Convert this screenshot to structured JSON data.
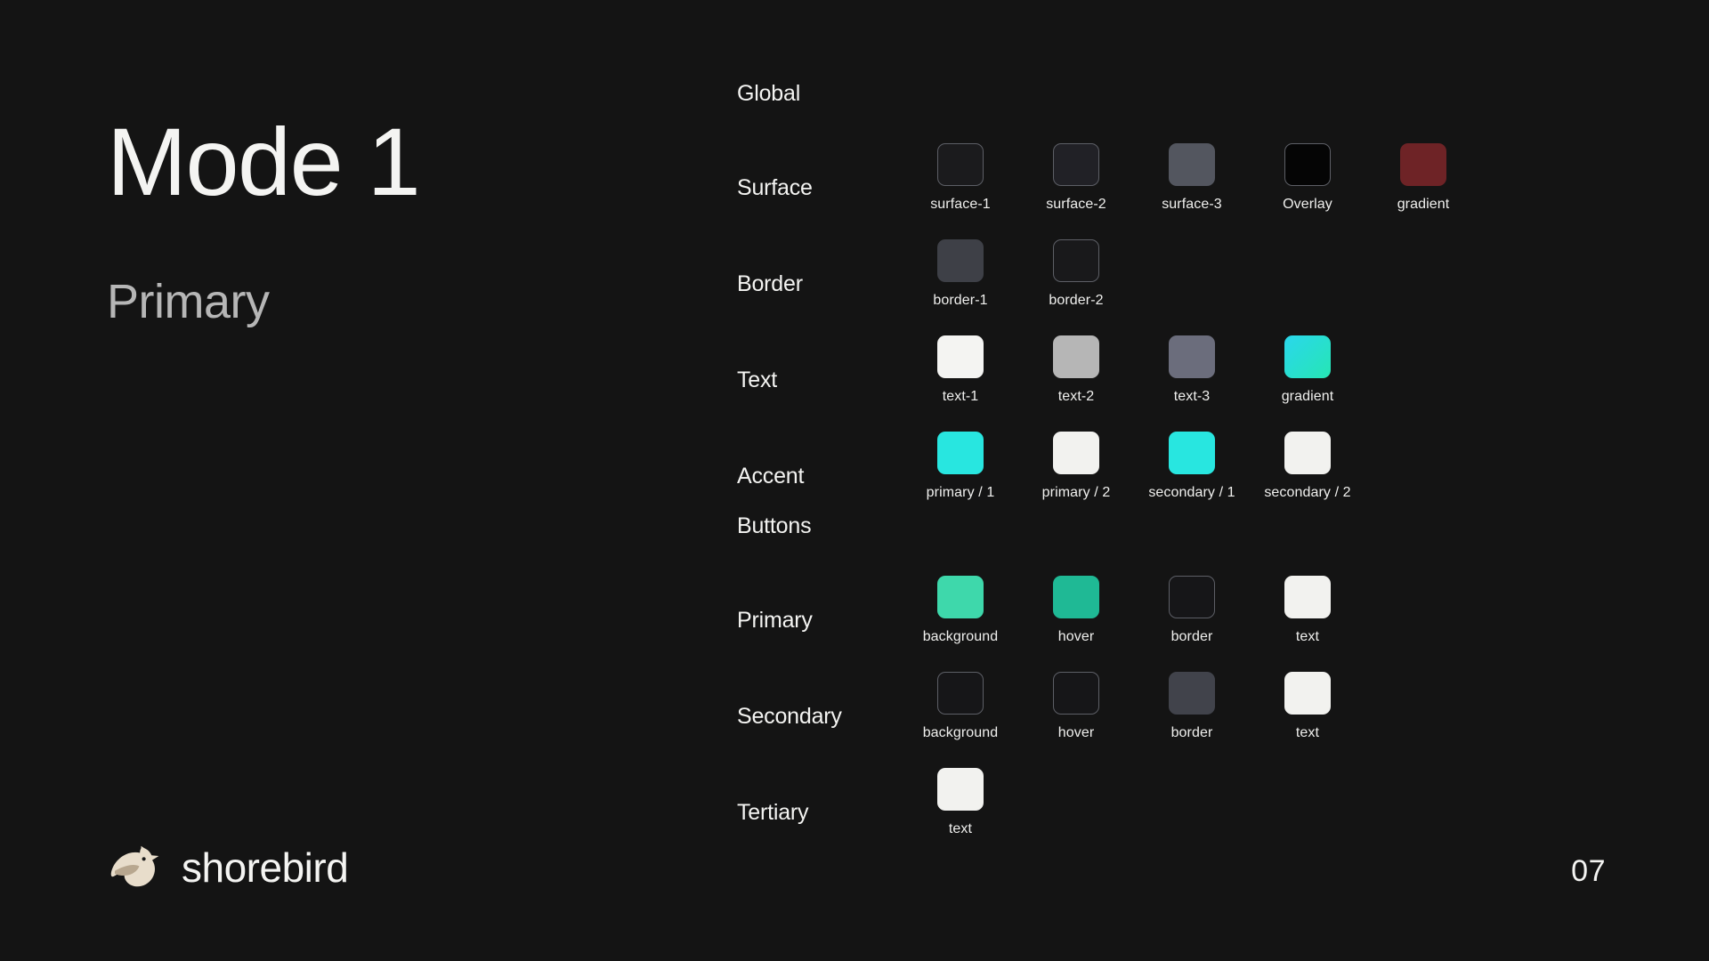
{
  "slide": {
    "title": "Mode 1",
    "subtitle": "Primary",
    "page_number": "07",
    "background": "#141414"
  },
  "brand": {
    "name": "shorebird",
    "logo_icon": "shorebird-bird-icon",
    "logo_color": "#e8ddcb"
  },
  "sections": [
    {
      "header": "Global",
      "rows": [
        {
          "label": "Surface",
          "swatches": [
            {
              "label": "surface-1",
              "color": "#1b1b1d",
              "outlined": true
            },
            {
              "label": "surface-2",
              "color": "#212126",
              "outlined": true
            },
            {
              "label": "surface-3",
              "color": "#53565f",
              "outlined": false
            },
            {
              "label": "Overlay",
              "color": "#050505",
              "outlined": true
            },
            {
              "label": "gradient",
              "color": "#6e2326",
              "outlined": false
            }
          ]
        },
        {
          "label": "Border",
          "swatches": [
            {
              "label": "border-1",
              "color": "#3e4047",
              "outlined": false
            },
            {
              "label": "border-2",
              "color": "#19191b",
              "outlined": true
            }
          ]
        },
        {
          "label": "Text",
          "swatches": [
            {
              "label": "text-1",
              "color": "#f4f4f2",
              "outlined": false
            },
            {
              "label": "text-2",
              "color": "#b6b6b6",
              "outlined": false
            },
            {
              "label": "text-3",
              "color": "#6b6d7c",
              "outlined": false
            },
            {
              "label": "gradient",
              "color": "linear-gradient(135deg, #2ad7ec 0%, #26e6b4 100%)",
              "outlined": false
            }
          ]
        },
        {
          "label": "Accent",
          "swatches": [
            {
              "label": "primary / 1",
              "color": "#28e6e0",
              "outlined": false
            },
            {
              "label": "primary / 2",
              "color": "#f2f2ef",
              "outlined": false
            },
            {
              "label": "secondary / 1",
              "color": "#28e6e0",
              "outlined": false
            },
            {
              "label": "secondary / 2",
              "color": "#f2f2ef",
              "outlined": false
            }
          ]
        }
      ]
    },
    {
      "header": "Buttons",
      "rows": [
        {
          "label": "Primary",
          "swatches": [
            {
              "label": "background",
              "color": "#3ed8ab",
              "outlined": false
            },
            {
              "label": "hover",
              "color": "#1fb995",
              "outlined": false
            },
            {
              "label": "border",
              "color": "#161618",
              "outlined": true
            },
            {
              "label": "text",
              "color": "#f2f2ef",
              "outlined": false
            }
          ]
        },
        {
          "label": "Secondary",
          "swatches": [
            {
              "label": "background",
              "color": "#161618",
              "outlined": true
            },
            {
              "label": "hover",
              "color": "#161618",
              "outlined": true
            },
            {
              "label": "border",
              "color": "#41434b",
              "outlined": false
            },
            {
              "label": "text",
              "color": "#f2f2ef",
              "outlined": false
            }
          ]
        },
        {
          "label": "Tertiary",
          "swatches": [
            {
              "label": "text",
              "color": "#f2f2ef",
              "outlined": false
            }
          ]
        }
      ]
    }
  ]
}
